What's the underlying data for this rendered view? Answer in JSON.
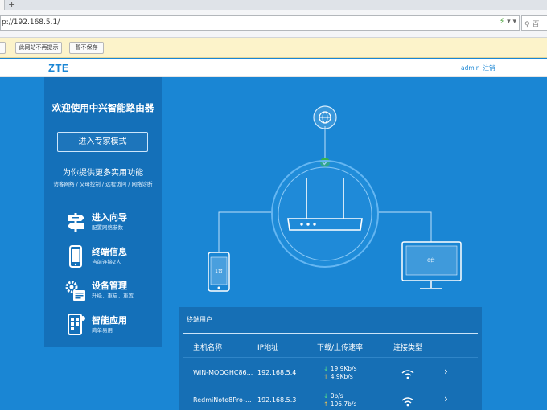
{
  "browser": {
    "new_tab_symbol": "+",
    "url": "p://192.168.5.1/",
    "search_placeholder": "百",
    "notify_buttons": [
      "此网站不再提示",
      "暂不保存"
    ]
  },
  "header": {
    "logo": "ZTE",
    "user": "admin",
    "logout": "注销"
  },
  "sidebar": {
    "welcome": "欢迎使用中兴智能路由器",
    "expert_mode_label": "进入专家模式",
    "subtitle": "为你提供更多实用功能",
    "features": "访客网络 / 父母控制 / 远程访问 / 网络诊断",
    "menu": [
      {
        "title": "进入向导",
        "sub": "配置网络参数",
        "icon": "signpost-icon"
      },
      {
        "title": "终端信息",
        "sub": "当前连接2人",
        "icon": "phone-icon"
      },
      {
        "title": "设备管理",
        "sub": "升级、重启、重置",
        "icon": "gears-icon"
      },
      {
        "title": "智能应用",
        "sub": "简单易用",
        "icon": "tablet-apps-icon"
      }
    ]
  },
  "diagram": {
    "phone_count": "1台",
    "pc_count": "0台",
    "internet_status": "connected"
  },
  "devices": {
    "title": "终端用户",
    "columns": [
      "主机名称",
      "IP地址",
      "下载/上传速率",
      "连接类型"
    ],
    "rows": [
      {
        "name": "WIN-MOQGHC86...",
        "ip": "192.168.5.4",
        "down": "19.9Kb/s",
        "up": "4.9Kb/s",
        "type": "wifi"
      },
      {
        "name": "RedmiNote8Pro-...",
        "ip": "192.168.5.3",
        "down": "0b/s",
        "up": "106.7b/s",
        "type": "wifi"
      }
    ]
  },
  "colors": {
    "background": "#1a86d4",
    "panel": "#1470b9",
    "table": "#166fb5",
    "brand": "#1a86d4",
    "check": "#35b44a",
    "notify": "#fcf3ca"
  }
}
